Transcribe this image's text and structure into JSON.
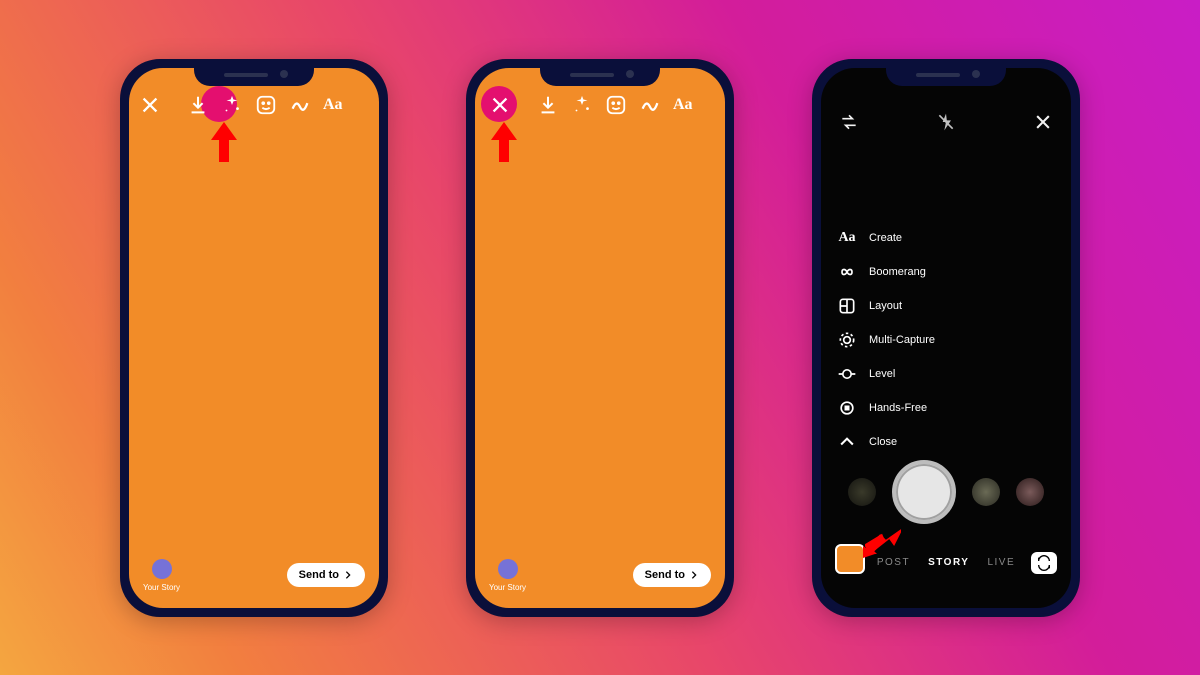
{
  "phone1": {
    "highlight_target": "download",
    "toolbar": {
      "close": "close",
      "download": "download",
      "effects": "sparkle",
      "sticker": "sticker",
      "draw": "squiggle",
      "text": "Aa"
    },
    "your_story": "Your Story",
    "send_to": "Send to"
  },
  "phone2": {
    "highlight_target": "close",
    "toolbar": {
      "close": "close",
      "download": "download",
      "effects": "sparkle",
      "sticker": "sticker",
      "draw": "squiggle",
      "text": "Aa"
    },
    "your_story": "Your Story",
    "send_to": "Send to"
  },
  "phone3": {
    "topbar": {
      "settings": "settings",
      "flash": "flash-off",
      "close": "close"
    },
    "modes": {
      "create": "Create",
      "boomerang": "Boomerang",
      "layout": "Layout",
      "multi_capture": "Multi-Capture",
      "level": "Level",
      "hands_free": "Hands-Free",
      "close": "Close"
    },
    "tabs": {
      "post": "POST",
      "story": "STORY",
      "live": "LIVE"
    }
  }
}
